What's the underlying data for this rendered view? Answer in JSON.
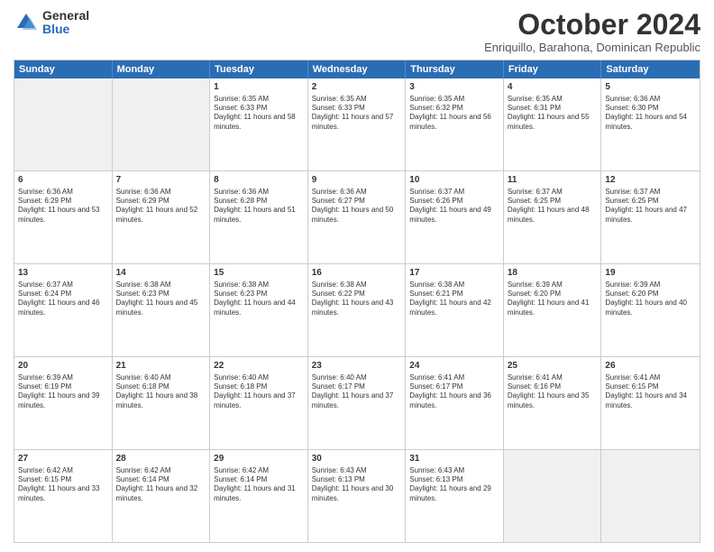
{
  "logo": {
    "general": "General",
    "blue": "Blue"
  },
  "header": {
    "month": "October 2024",
    "location": "Enriquillo, Barahona, Dominican Republic"
  },
  "days": [
    "Sunday",
    "Monday",
    "Tuesday",
    "Wednesday",
    "Thursday",
    "Friday",
    "Saturday"
  ],
  "weeks": [
    [
      {
        "day": "",
        "info": ""
      },
      {
        "day": "",
        "info": ""
      },
      {
        "day": "1",
        "info": "Sunrise: 6:35 AM\nSunset: 6:33 PM\nDaylight: 11 hours and 58 minutes."
      },
      {
        "day": "2",
        "info": "Sunrise: 6:35 AM\nSunset: 6:33 PM\nDaylight: 11 hours and 57 minutes."
      },
      {
        "day": "3",
        "info": "Sunrise: 6:35 AM\nSunset: 6:32 PM\nDaylight: 11 hours and 56 minutes."
      },
      {
        "day": "4",
        "info": "Sunrise: 6:35 AM\nSunset: 6:31 PM\nDaylight: 11 hours and 55 minutes."
      },
      {
        "day": "5",
        "info": "Sunrise: 6:36 AM\nSunset: 6:30 PM\nDaylight: 11 hours and 54 minutes."
      }
    ],
    [
      {
        "day": "6",
        "info": "Sunrise: 6:36 AM\nSunset: 6:29 PM\nDaylight: 11 hours and 53 minutes."
      },
      {
        "day": "7",
        "info": "Sunrise: 6:36 AM\nSunset: 6:29 PM\nDaylight: 11 hours and 52 minutes."
      },
      {
        "day": "8",
        "info": "Sunrise: 6:36 AM\nSunset: 6:28 PM\nDaylight: 11 hours and 51 minutes."
      },
      {
        "day": "9",
        "info": "Sunrise: 6:36 AM\nSunset: 6:27 PM\nDaylight: 11 hours and 50 minutes."
      },
      {
        "day": "10",
        "info": "Sunrise: 6:37 AM\nSunset: 6:26 PM\nDaylight: 11 hours and 49 minutes."
      },
      {
        "day": "11",
        "info": "Sunrise: 6:37 AM\nSunset: 6:25 PM\nDaylight: 11 hours and 48 minutes."
      },
      {
        "day": "12",
        "info": "Sunrise: 6:37 AM\nSunset: 6:25 PM\nDaylight: 11 hours and 47 minutes."
      }
    ],
    [
      {
        "day": "13",
        "info": "Sunrise: 6:37 AM\nSunset: 6:24 PM\nDaylight: 11 hours and 46 minutes."
      },
      {
        "day": "14",
        "info": "Sunrise: 6:38 AM\nSunset: 6:23 PM\nDaylight: 11 hours and 45 minutes."
      },
      {
        "day": "15",
        "info": "Sunrise: 6:38 AM\nSunset: 6:23 PM\nDaylight: 11 hours and 44 minutes."
      },
      {
        "day": "16",
        "info": "Sunrise: 6:38 AM\nSunset: 6:22 PM\nDaylight: 11 hours and 43 minutes."
      },
      {
        "day": "17",
        "info": "Sunrise: 6:38 AM\nSunset: 6:21 PM\nDaylight: 11 hours and 42 minutes."
      },
      {
        "day": "18",
        "info": "Sunrise: 6:39 AM\nSunset: 6:20 PM\nDaylight: 11 hours and 41 minutes."
      },
      {
        "day": "19",
        "info": "Sunrise: 6:39 AM\nSunset: 6:20 PM\nDaylight: 11 hours and 40 minutes."
      }
    ],
    [
      {
        "day": "20",
        "info": "Sunrise: 6:39 AM\nSunset: 6:19 PM\nDaylight: 11 hours and 39 minutes."
      },
      {
        "day": "21",
        "info": "Sunrise: 6:40 AM\nSunset: 6:18 PM\nDaylight: 11 hours and 38 minutes."
      },
      {
        "day": "22",
        "info": "Sunrise: 6:40 AM\nSunset: 6:18 PM\nDaylight: 11 hours and 37 minutes."
      },
      {
        "day": "23",
        "info": "Sunrise: 6:40 AM\nSunset: 6:17 PM\nDaylight: 11 hours and 37 minutes."
      },
      {
        "day": "24",
        "info": "Sunrise: 6:41 AM\nSunset: 6:17 PM\nDaylight: 11 hours and 36 minutes."
      },
      {
        "day": "25",
        "info": "Sunrise: 6:41 AM\nSunset: 6:16 PM\nDaylight: 11 hours and 35 minutes."
      },
      {
        "day": "26",
        "info": "Sunrise: 6:41 AM\nSunset: 6:15 PM\nDaylight: 11 hours and 34 minutes."
      }
    ],
    [
      {
        "day": "27",
        "info": "Sunrise: 6:42 AM\nSunset: 6:15 PM\nDaylight: 11 hours and 33 minutes."
      },
      {
        "day": "28",
        "info": "Sunrise: 6:42 AM\nSunset: 6:14 PM\nDaylight: 11 hours and 32 minutes."
      },
      {
        "day": "29",
        "info": "Sunrise: 6:42 AM\nSunset: 6:14 PM\nDaylight: 11 hours and 31 minutes."
      },
      {
        "day": "30",
        "info": "Sunrise: 6:43 AM\nSunset: 6:13 PM\nDaylight: 11 hours and 30 minutes."
      },
      {
        "day": "31",
        "info": "Sunrise: 6:43 AM\nSunset: 6:13 PM\nDaylight: 11 hours and 29 minutes."
      },
      {
        "day": "",
        "info": ""
      },
      {
        "day": "",
        "info": ""
      }
    ]
  ]
}
